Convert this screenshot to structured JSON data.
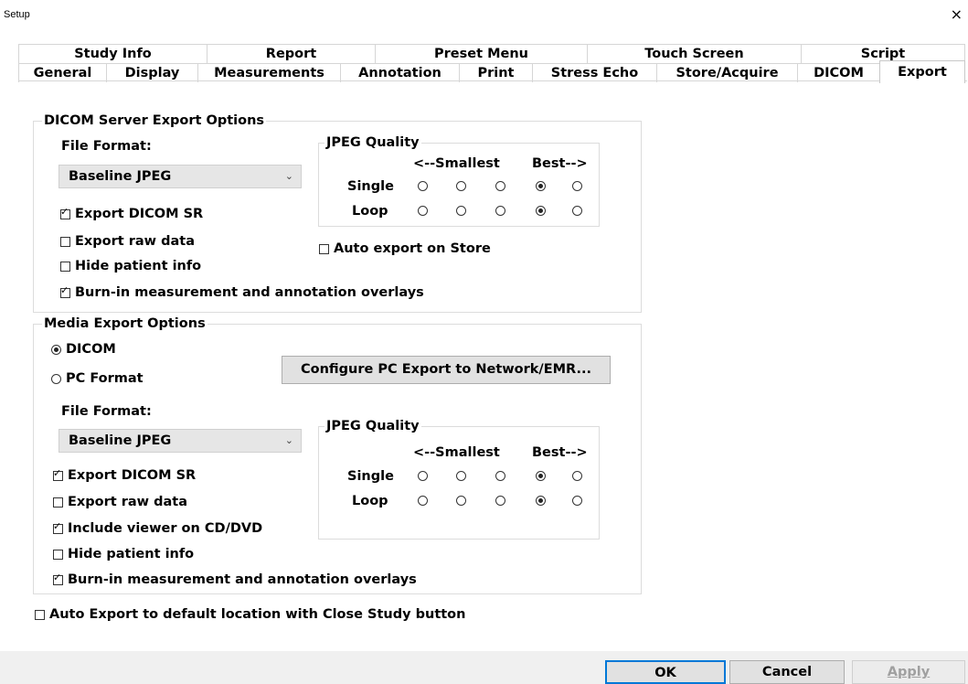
{
  "window": {
    "title": "Setup",
    "close": "×"
  },
  "tabs_row1": [
    "Study Info",
    "Report",
    "Preset Menu",
    "Touch Screen",
    "Script"
  ],
  "tabs_row2": [
    "General",
    "Display",
    "Measurements",
    "Annotation",
    "Print",
    "Stress Echo",
    "Store/Acquire",
    "DICOM",
    "Export"
  ],
  "active_tab": "Export",
  "dicom_server": {
    "group_label": "DICOM Server Export Options",
    "file_format_label": "File Format:",
    "file_format_value": "Baseline JPEG",
    "jpeg_quality": {
      "label": "JPEG Quality",
      "smallest": "<--Smallest",
      "best": "Best-->",
      "single_label": "Single",
      "loop_label": "Loop",
      "single_selected": 4,
      "loop_selected": 4
    },
    "checks": [
      {
        "label": "Export DICOM SR",
        "checked": true
      },
      {
        "label": "Export raw data",
        "checked": false
      },
      {
        "label": "Hide patient info",
        "checked": false
      },
      {
        "label": "Burn-in measurement and annotation overlays",
        "checked": true
      }
    ],
    "auto_export": {
      "label": "Auto export on Store",
      "checked": false
    }
  },
  "media": {
    "group_label": "Media Export Options",
    "radio_dicom": "DICOM",
    "radio_pc": "PC Format",
    "selected": "DICOM",
    "configure_button": "Configure PC Export to Network/EMR...",
    "file_format_label": "File Format:",
    "file_format_value": "Baseline JPEG",
    "jpeg_quality": {
      "label": "JPEG Quality",
      "smallest": "<--Smallest",
      "best": "Best-->",
      "single_label": "Single",
      "loop_label": "Loop",
      "single_selected": 4,
      "loop_selected": 4
    },
    "checks": [
      {
        "label": "Export DICOM SR",
        "checked": true
      },
      {
        "label": "Export raw data",
        "checked": false
      },
      {
        "label": "Include viewer on CD/DVD",
        "checked": true
      },
      {
        "label": "Hide patient info",
        "checked": false
      },
      {
        "label": "Burn-in measurement and annotation overlays",
        "checked": true
      }
    ]
  },
  "auto_export_close": {
    "label": "Auto Export to default location with Close Study button",
    "checked": false
  },
  "buttons": {
    "ok": "OK",
    "cancel": "Cancel",
    "apply": "Apply"
  }
}
